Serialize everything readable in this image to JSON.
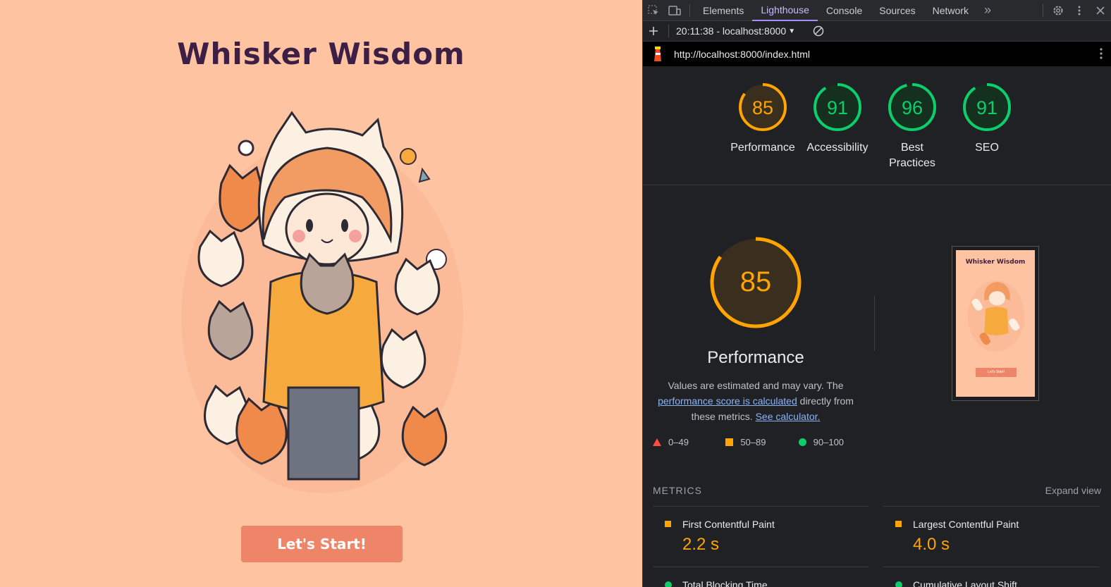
{
  "app": {
    "title": "Whisker Wisdom",
    "start_button": "Let's Start!"
  },
  "devtools": {
    "tabs": [
      "Elements",
      "Lighthouse",
      "Console",
      "Sources",
      "Network"
    ],
    "active_tab": "Lighthouse",
    "overflow_label": "»",
    "report_selector": "20:11:38 - localhost:8000",
    "url": "http://localhost:8000/index.html",
    "scores": [
      {
        "label": "Performance",
        "score": "85",
        "value": 85,
        "status": "average"
      },
      {
        "label": "Accessibility",
        "score": "91",
        "value": 91,
        "status": "pass"
      },
      {
        "label": "Best Practices",
        "score": "96",
        "value": 96,
        "status": "pass"
      },
      {
        "label": "SEO",
        "score": "91",
        "value": 91,
        "status": "pass"
      }
    ],
    "performance": {
      "score": "85",
      "value": 85,
      "title": "Performance",
      "desc_1": "Values are estimated and may vary. The",
      "desc_link_1": "performance score is calculated",
      "desc_2": "directly from these metrics.",
      "desc_link_2": "See calculator."
    },
    "legend": [
      {
        "label": "0–49",
        "shape": "triangle",
        "color": "#ff4e42"
      },
      {
        "label": "50–89",
        "shape": "square",
        "color": "#ffa400"
      },
      {
        "label": "90–100",
        "shape": "circle",
        "color": "#0cce6b"
      }
    ],
    "thumbnail": {
      "title": "Whisker Wisdom",
      "button": "Let's Start!"
    },
    "metrics_heading": "METRICS",
    "expand_view": "Expand view",
    "metrics": [
      {
        "name": "First Contentful Paint",
        "value": "2.2 s",
        "status": "average"
      },
      {
        "name": "Largest Contentful Paint",
        "value": "4.0 s",
        "status": "average"
      },
      {
        "name": "Total Blocking Time",
        "value": "",
        "status": "pass"
      },
      {
        "name": "Cumulative Layout Shift",
        "value": "",
        "status": "pass"
      }
    ],
    "colors": {
      "pass": "#0cce6b",
      "average": "#ffa400",
      "fail": "#ff4e42",
      "accent": "#a78bfa"
    }
  }
}
